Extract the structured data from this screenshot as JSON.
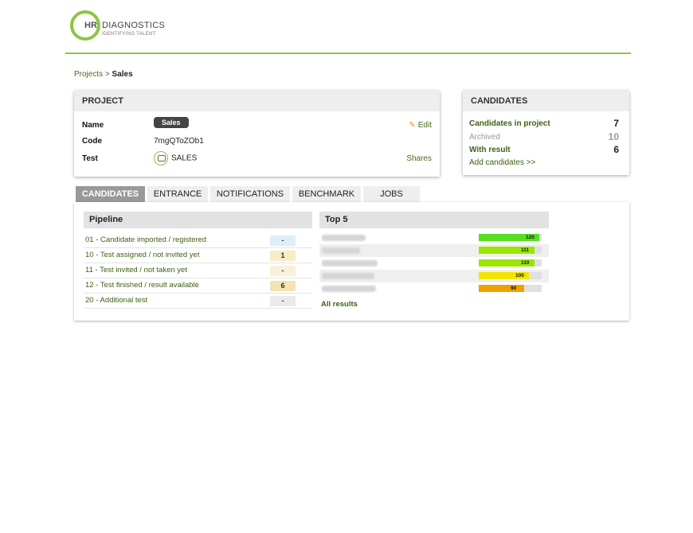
{
  "logo": {
    "initials": "HR",
    "name": "DIAGNOSTICS",
    "tagline": "IDENTIFYING TALENT"
  },
  "breadcrumb": {
    "parent": "Projects",
    "separator": ">",
    "current": "Sales"
  },
  "project": {
    "heading": "PROJECT",
    "name_label": "Name",
    "name_value": "Sales",
    "code_label": "Code",
    "code_value": "7mgQToZOb1",
    "test_label": "Test",
    "test_value": "SALES",
    "edit_label": "Edit",
    "shares_label": "Shares"
  },
  "candidates_panel": {
    "heading": "CANDIDATES",
    "in_project_label": "Candidates in project",
    "in_project_count": "7",
    "archived_label": "Archived",
    "archived_count": "10",
    "with_result_label": "With result",
    "with_result_count": "6",
    "add_label": "Add candidates >>"
  },
  "tabs": [
    "CANDIDATES",
    "ENTRANCE",
    "NOTIFICATIONS",
    "BENCHMARK",
    "JOBS"
  ],
  "active_tab": "CANDIDATES",
  "pipeline": {
    "heading": "Pipeline",
    "rows": [
      {
        "label": "01 - Candidate imported / registered",
        "count": "-",
        "color": "#dceef8"
      },
      {
        "label": "10 - Test assigned / not invited yet",
        "count": "1",
        "color": "#f8ecc8"
      },
      {
        "label": "11 - Test invited / not taken yet",
        "count": "-",
        "color": "#f8f0d8"
      },
      {
        "label": "12 - Test finished / result available",
        "count": "6",
        "color": "#f4e4b4"
      },
      {
        "label": "20 - Additional test",
        "count": "-",
        "color": "#eaeaea"
      }
    ]
  },
  "top5": {
    "heading": "Top 5",
    "bar_max": 125,
    "rows": [
      {
        "score": "120",
        "value": 120,
        "color": "#55e01f"
      },
      {
        "score": "111",
        "value": 111,
        "color": "#9ae600"
      },
      {
        "score": "110",
        "value": 110,
        "color": "#9ae600"
      },
      {
        "score": "100",
        "value": 100,
        "color": "#f0e600"
      },
      {
        "score": "90",
        "value": 90,
        "color": "#f0a000"
      }
    ],
    "all_results_label": "All results"
  }
}
